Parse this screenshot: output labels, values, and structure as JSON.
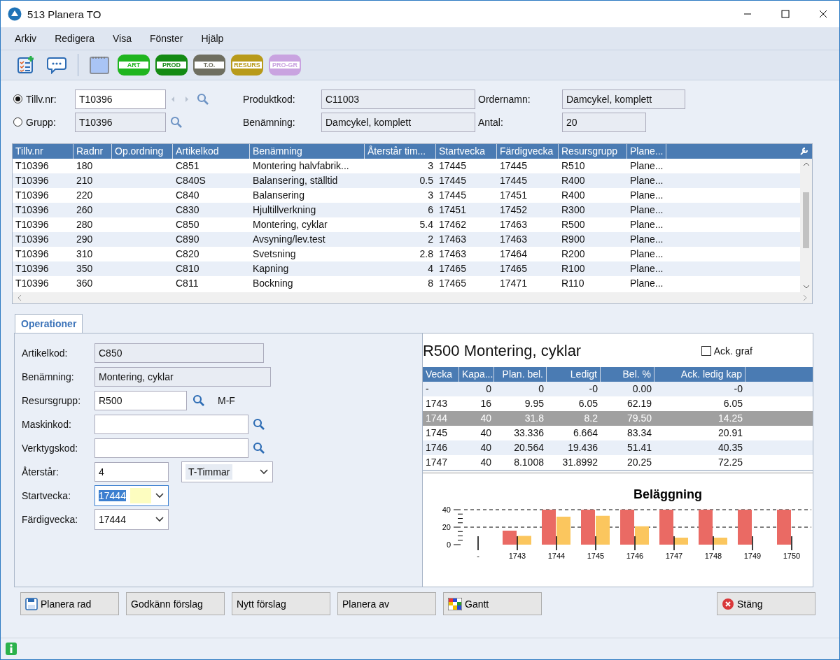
{
  "window": {
    "title": "513 Planera TO"
  },
  "menu": [
    {
      "label": "Arkiv"
    },
    {
      "label": "Redigera"
    },
    {
      "label": "Visa"
    },
    {
      "label": "Fönster"
    },
    {
      "label": "Hjälp"
    }
  ],
  "toolbar": [
    [
      {
        "kind": "checklist"
      },
      {
        "kind": "chat"
      }
    ],
    [
      {
        "kind": "notepad"
      },
      {
        "kind": "badge",
        "label": "ART",
        "color": "#1fb51f"
      },
      {
        "kind": "badge",
        "label": "PROD",
        "color": "#138a13"
      },
      {
        "kind": "badge",
        "label": "T.O.",
        "color": "#6e6e60"
      },
      {
        "kind": "badge",
        "label": "RESURS",
        "color": "#b89a1a"
      },
      {
        "kind": "badge",
        "label": "PRO-GR",
        "color": "#c9a3e0"
      }
    ]
  ],
  "order_form": {
    "choices": [
      {
        "label": "Tillv.nr:",
        "selected": true,
        "value": "T10396"
      },
      {
        "label": "Grupp:",
        "selected": false,
        "value": "T10396"
      }
    ],
    "fields": [
      {
        "label": "Produktkod:",
        "value": "C11003"
      },
      {
        "label": "Benämning:",
        "value": "Damcykel, komplett"
      },
      {
        "label": "Ordernamn:",
        "value": "Damcykel, komplett"
      },
      {
        "label": "Antal:",
        "value": "20"
      }
    ]
  },
  "table": {
    "columns": [
      "Tillv.nr",
      "Radnr",
      "Op.ordning",
      "Artikelkod",
      "Benämning",
      "Återstår tim...",
      "Startvecka",
      "Färdigvecka",
      "Resursgrupp",
      "Plane..."
    ],
    "rows": [
      [
        "T10396",
        "180",
        null,
        "C851",
        "Montering halvfabrik...",
        "3",
        "17445",
        "17445",
        "R510",
        "Plane..."
      ],
      [
        "T10396",
        "210",
        null,
        "C840S",
        "Balansering, ställtid",
        "0.5",
        "17445",
        "17445",
        "R400",
        "Plane..."
      ],
      [
        "T10396",
        "220",
        null,
        "C840",
        "Balansering",
        "3",
        "17445",
        "17451",
        "R400",
        "Plane..."
      ],
      [
        "T10396",
        "260",
        null,
        "C830",
        "Hjultillverkning",
        "6",
        "17451",
        "17452",
        "R300",
        "Plane..."
      ],
      [
        "T10396",
        "280",
        null,
        "C850",
        "Montering, cyklar",
        "5.4",
        "17462",
        "17463",
        "R500",
        "Plane..."
      ],
      [
        "T10396",
        "290",
        null,
        "C890",
        "Avsyning/lev.test",
        "2",
        "17463",
        "17463",
        "R900",
        "Plane..."
      ],
      [
        "T10396",
        "310",
        null,
        "C820",
        "Svetsning",
        "2.8",
        "17463",
        "17464",
        "R200",
        "Plane..."
      ],
      [
        "T10396",
        "350",
        null,
        "C810",
        "Kapning",
        "4",
        "17465",
        "17465",
        "R100",
        "Plane..."
      ],
      [
        "T10396",
        "360",
        null,
        "C811",
        "Bockning",
        "8",
        "17465",
        "17471",
        "R110",
        "Plane..."
      ]
    ]
  },
  "tabs": [
    {
      "label": "Operationer",
      "selected": true
    }
  ],
  "operation": [
    {
      "kind": "readonly",
      "label": "Artikelkod:",
      "value": "C850"
    },
    {
      "kind": "readonly-wide",
      "label": "Benämning:",
      "value": "Montering, cyklar"
    },
    {
      "kind": "lookup",
      "label": "Resursgrupp:",
      "value": "R500",
      "note": "M-F"
    },
    {
      "kind": "lookup-wide",
      "label": "Maskinkod:"
    },
    {
      "kind": "lookup-wide",
      "label": "Verktygskod:"
    },
    {
      "kind": "quantity",
      "label": "Återstår:",
      "value": "4",
      "unit": "T-Timmar"
    },
    {
      "kind": "combo",
      "label": "Startvecka:",
      "value": "17444",
      "focused": true
    },
    {
      "kind": "combo",
      "label": "Färdigvecka:",
      "value": "17444",
      "focused": false
    }
  ],
  "resource": {
    "title": "R500 Montering, cyklar",
    "ack_graf": {
      "label": "Ack. graf",
      "checked": false
    },
    "columns": [
      "Vecka",
      "Kapa...",
      "Plan. bel.",
      "Ledigt",
      "Bel. %",
      "Ack. ledig kap"
    ],
    "rows": [
      {
        "cells": [
          "-",
          "0",
          "0",
          "-0",
          "0.00",
          "-0"
        ],
        "selected": false
      },
      {
        "cells": [
          "1743",
          "16",
          "9.95",
          "6.05",
          "62.19",
          "6.05"
        ],
        "selected": false
      },
      {
        "cells": [
          "1744",
          "40",
          "31.8",
          "8.2",
          "79.50",
          "14.25"
        ],
        "selected": true
      },
      {
        "cells": [
          "1745",
          "40",
          "33.336",
          "6.664",
          "83.34",
          "20.91"
        ],
        "selected": false
      },
      {
        "cells": [
          "1746",
          "40",
          "20.564",
          "19.436",
          "51.41",
          "40.35"
        ],
        "selected": false
      },
      {
        "cells": [
          "1747",
          "40",
          "8.1008",
          "31.8992",
          "20.25",
          "72.25"
        ],
        "selected": false
      }
    ],
    "chart_data": {
      "type": "bar",
      "title": "Beläggning",
      "categories": [
        "-",
        "1743",
        "1744",
        "1745",
        "1746",
        "1747",
        "1748",
        "1749",
        "1750"
      ],
      "series": [
        {
          "color": "#ea6a64",
          "values": [
            0,
            16,
            40,
            40,
            40,
            40,
            40,
            40,
            40
          ]
        },
        {
          "color": "#fbc65e",
          "values": [
            0,
            10,
            32,
            33,
            21,
            8,
            8,
            0,
            0
          ]
        }
      ],
      "ylim": [
        0,
        40
      ],
      "yticks": [
        0,
        20,
        40
      ]
    }
  },
  "buttons": [
    {
      "kind": "save",
      "label": "Planera rad"
    },
    {
      "kind": "plain",
      "label": "Godkänn förslag"
    },
    {
      "kind": "plain",
      "label": "Nytt förslag"
    },
    {
      "kind": "plain",
      "label": "Planera av"
    },
    {
      "kind": "gantt",
      "label": "Gantt"
    },
    {
      "kind": "close",
      "label": "Stäng"
    }
  ]
}
